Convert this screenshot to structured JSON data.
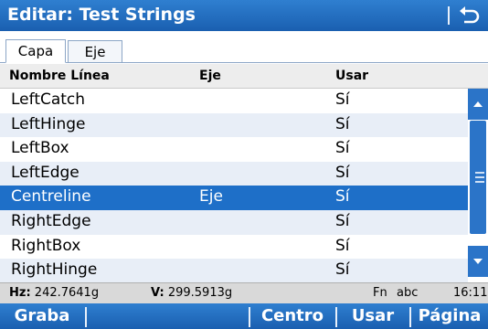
{
  "window": {
    "title": "Editar: Test Strings"
  },
  "tabs": [
    {
      "label": "Capa",
      "active": true
    },
    {
      "label": "Eje",
      "active": false
    }
  ],
  "table": {
    "columns": [
      "Nombre Línea",
      "Eje",
      "Usar"
    ],
    "rows": [
      {
        "name": "LeftCatch",
        "eje": "",
        "usar": "Sí"
      },
      {
        "name": "LeftHinge",
        "eje": "",
        "usar": "Sí"
      },
      {
        "name": "LeftBox",
        "eje": "",
        "usar": "Sí"
      },
      {
        "name": "LeftEdge",
        "eje": "",
        "usar": "Sí"
      },
      {
        "name": "Centreline",
        "eje": "Eje",
        "usar": "Sí"
      },
      {
        "name": "RightEdge",
        "eje": "",
        "usar": "Sí"
      },
      {
        "name": "RightBox",
        "eje": "",
        "usar": "Sí"
      },
      {
        "name": "RightHinge",
        "eje": "",
        "usar": "Sí"
      }
    ],
    "selected_row": "Centreline"
  },
  "status": {
    "hz_label": "Hz:",
    "hz_value": "242.7641g",
    "v_label": "V:",
    "v_value": "299.5913g",
    "fn": "Fn",
    "mode": "abc",
    "time": "16:11"
  },
  "softkeys": {
    "f1": "Graba",
    "f2": "",
    "f3": "",
    "f4": "Centro",
    "f5": "Usar",
    "f6": "Página"
  },
  "icons": {
    "back": "back-arrow-icon",
    "scroll_up": "arrow-up-icon",
    "scroll_down": "arrow-down-icon"
  },
  "colors": {
    "accent": "#1e6fc8",
    "bar": "#1a5fb0",
    "row_alt": "#e8eef7"
  }
}
